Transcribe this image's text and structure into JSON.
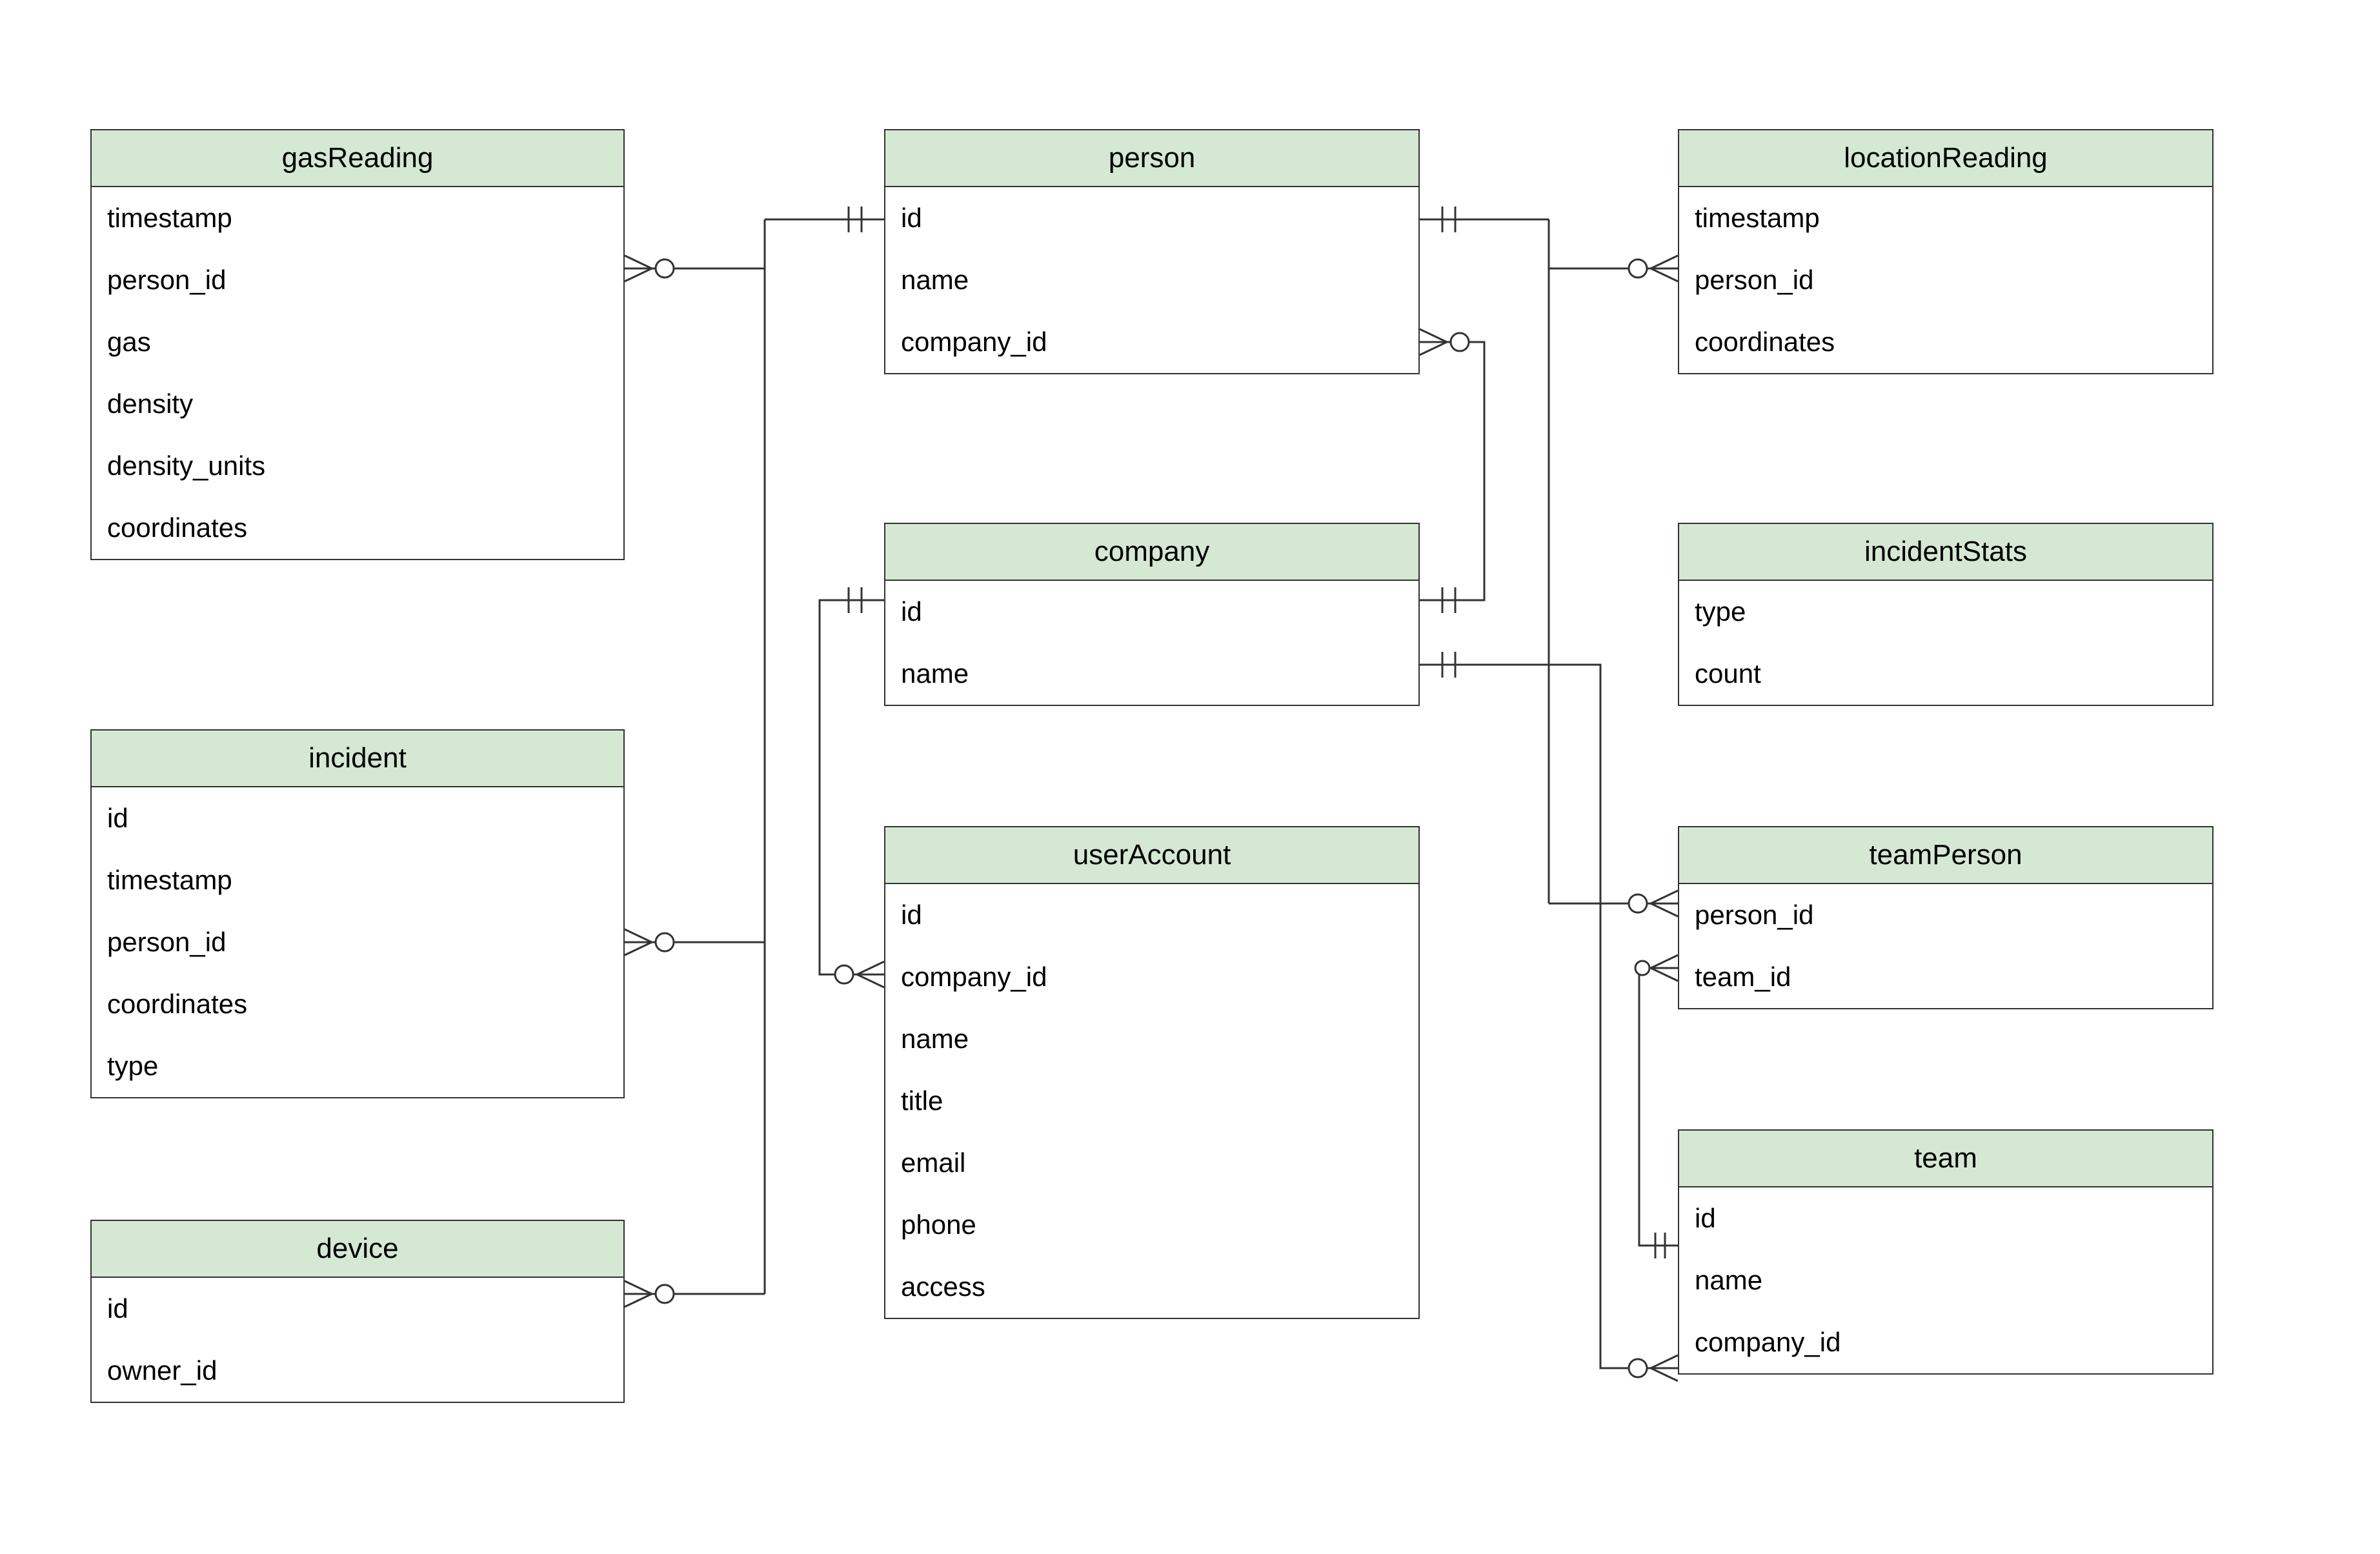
{
  "entities": {
    "gasReading": {
      "title": "gasReading",
      "attrs": [
        "timestamp",
        "person_id",
        "gas",
        "density",
        "density_units",
        "coordinates"
      ]
    },
    "incident": {
      "title": "incident",
      "attrs": [
        "id",
        "timestamp",
        "person_id",
        "coordinates",
        "type"
      ]
    },
    "device": {
      "title": "device",
      "attrs": [
        "id",
        "owner_id"
      ]
    },
    "person": {
      "title": "person",
      "attrs": [
        "id",
        "name",
        "company_id"
      ]
    },
    "company": {
      "title": "company",
      "attrs": [
        "id",
        "name"
      ]
    },
    "userAccount": {
      "title": "userAccount",
      "attrs": [
        "id",
        "company_id",
        "name",
        "title",
        "email",
        "phone",
        "access"
      ]
    },
    "locationReading": {
      "title": "locationReading",
      "attrs": [
        "timestamp",
        "person_id",
        "coordinates"
      ]
    },
    "incidentStats": {
      "title": "incidentStats",
      "attrs": [
        "type",
        "count"
      ]
    },
    "teamPerson": {
      "title": "teamPerson",
      "attrs": [
        "person_id",
        "team_id"
      ]
    },
    "team": {
      "title": "team",
      "attrs": [
        "id",
        "name",
        "company_id"
      ]
    }
  },
  "relationships": [
    {
      "from": "person",
      "to": "gasReading",
      "fromCard": "one",
      "toCard": "zero-or-many"
    },
    {
      "from": "person",
      "to": "incident",
      "fromCard": "one",
      "toCard": "zero-or-many"
    },
    {
      "from": "person",
      "to": "device",
      "fromCard": "one",
      "toCard": "zero-or-many"
    },
    {
      "from": "person",
      "to": "locationReading",
      "fromCard": "one",
      "toCard": "zero-or-many"
    },
    {
      "from": "person",
      "to": "teamPerson",
      "fromCard": "one",
      "toCard": "zero-or-many"
    },
    {
      "from": "company",
      "to": "person",
      "fromCard": "one",
      "toCard": "zero-or-many"
    },
    {
      "from": "company",
      "to": "userAccount",
      "fromCard": "one",
      "toCard": "zero-or-many"
    },
    {
      "from": "company",
      "to": "team",
      "fromCard": "one",
      "toCard": "zero-or-many"
    },
    {
      "from": "team",
      "to": "teamPerson",
      "fromCard": "one",
      "toCard": "zero-or-many"
    }
  ]
}
